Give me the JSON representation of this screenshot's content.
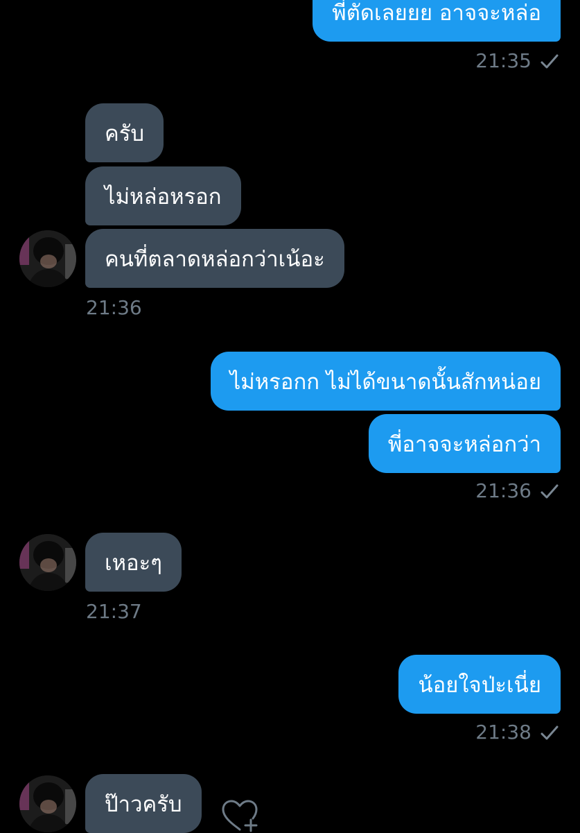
{
  "colors": {
    "background": "#000000",
    "sent_bubble": "#1d9bf0",
    "received_bubble": "#3c4a58",
    "timestamp": "#6e7b87"
  },
  "messages": [
    {
      "direction": "sent",
      "text": "พี่ตัดเลยยย อาจจะหล่อ"
    },
    {
      "direction": "sent",
      "time": "21:35",
      "read_icon": "checkmark-icon"
    },
    {
      "direction": "received",
      "text": "ครับ"
    },
    {
      "direction": "received",
      "text": "ไม่หล่อหรอก"
    },
    {
      "direction": "received",
      "text": "คนที่ตลาดหล่อกว่าเน้อะ"
    },
    {
      "direction": "received",
      "time": "21:36"
    },
    {
      "direction": "sent",
      "text": "ไม่หรอกก ไม่ได้ขนาดนั้นสักหน่อย"
    },
    {
      "direction": "sent",
      "text": "พี่อาจจะหล่อกว่า"
    },
    {
      "direction": "sent",
      "time": "21:36",
      "read_icon": "checkmark-icon"
    },
    {
      "direction": "received",
      "text": "เหอะๆ"
    },
    {
      "direction": "received",
      "time": "21:37"
    },
    {
      "direction": "sent",
      "text": "น้อยใจป่ะเนี่ย"
    },
    {
      "direction": "sent",
      "time": "21:38",
      "read_icon": "checkmark-icon"
    },
    {
      "direction": "received",
      "text": "ป๊าวครับ",
      "reaction_icon": "heart-plus-icon"
    }
  ]
}
